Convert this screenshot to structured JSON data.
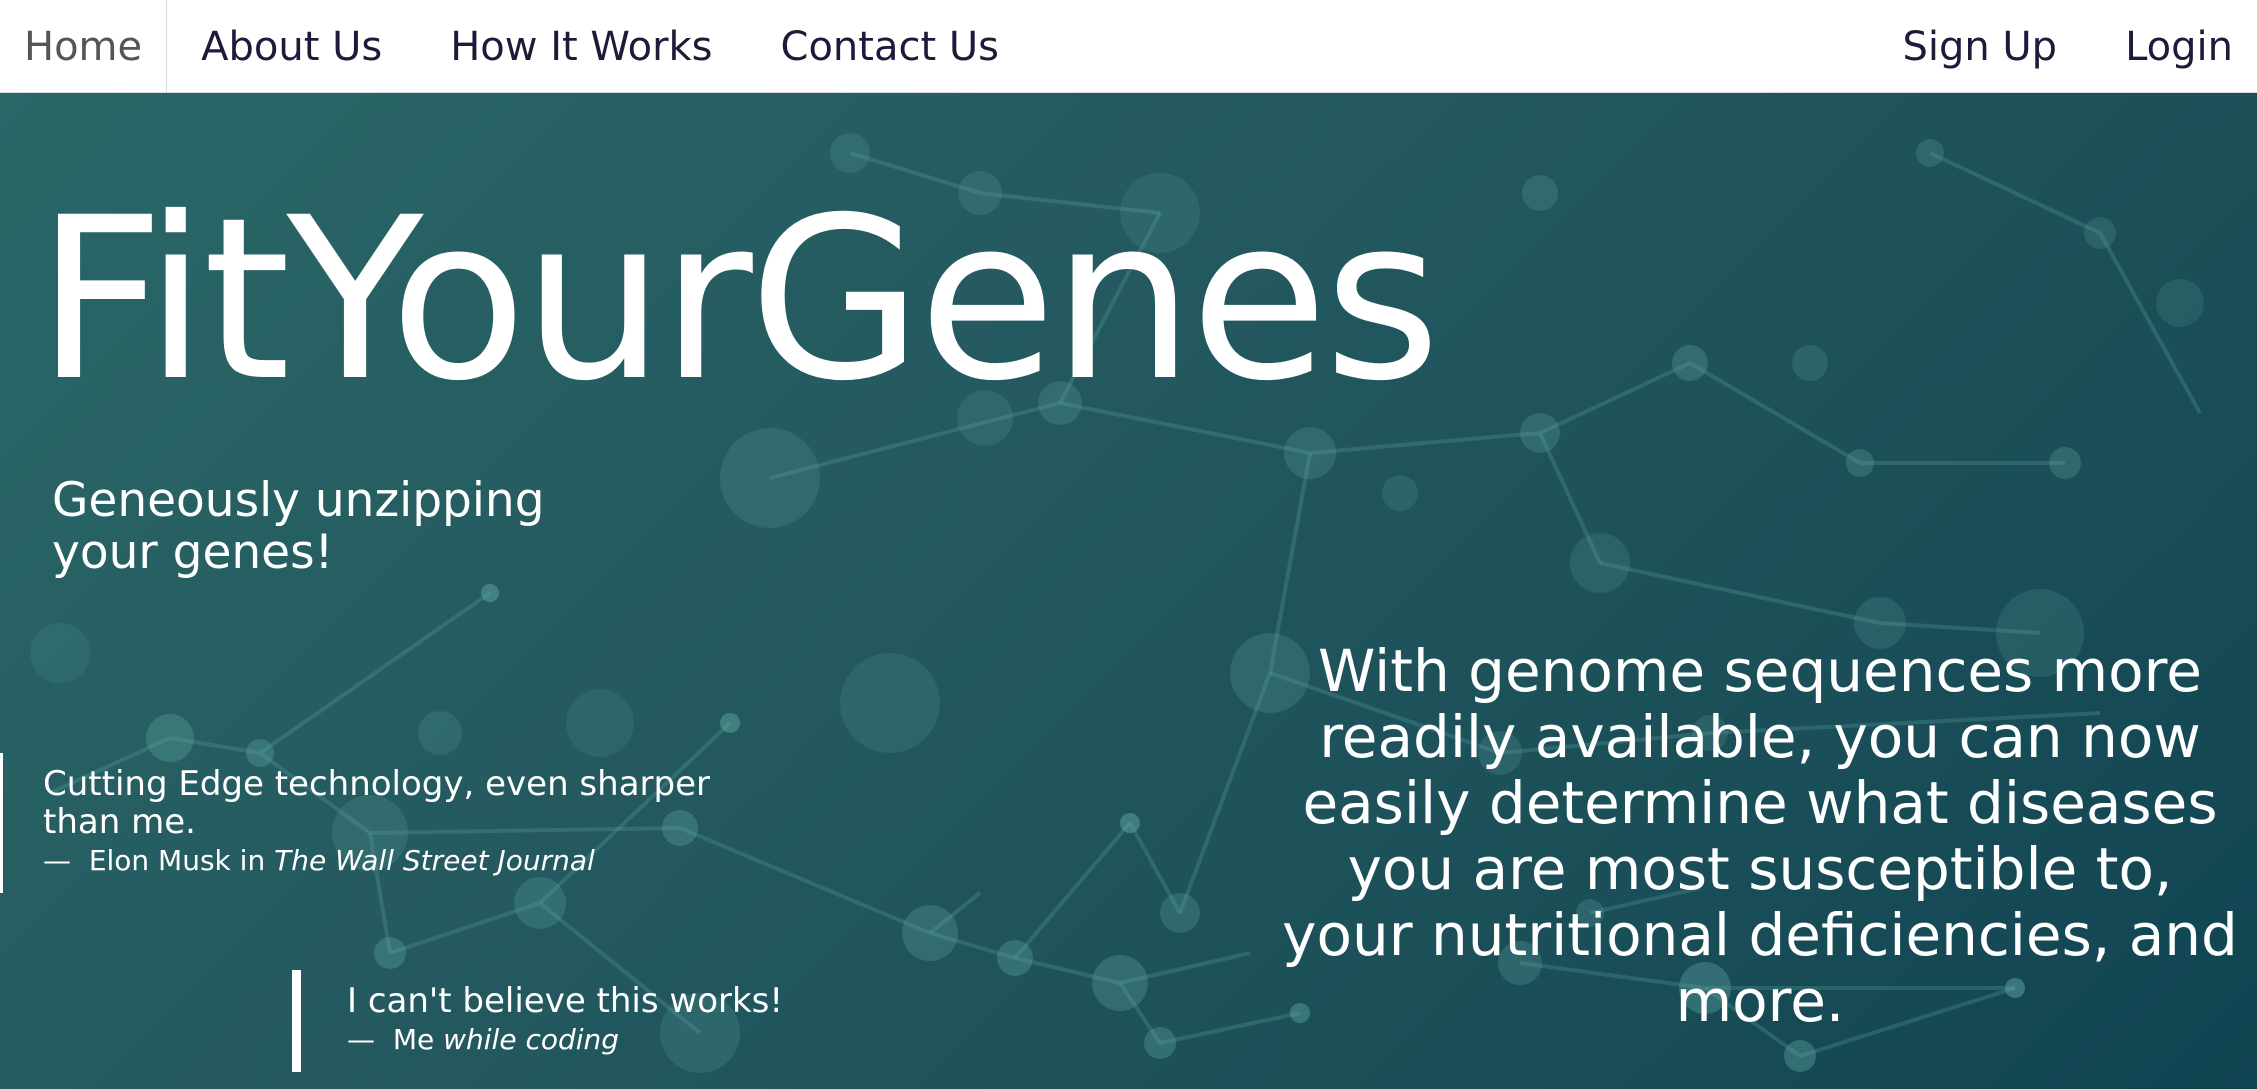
{
  "nav": {
    "left_items": [
      {
        "label": "Home",
        "active": true
      },
      {
        "label": "About Us",
        "active": false
      },
      {
        "label": "How It Works",
        "active": false
      },
      {
        "label": "Contact Us",
        "active": false
      }
    ],
    "right_items": [
      {
        "label": "Sign Up"
      },
      {
        "label": "Login"
      }
    ]
  },
  "hero": {
    "title": "FitYourGenes",
    "tagline": "Geneously unzipping your genes!",
    "blurb": "With genome sequences more readily available, you can now easily determine what diseases you are most susceptible to, your nutritional deficiencies, and more.",
    "quotes": [
      {
        "text": "Cutting Edge technology, even sharper than me.",
        "dash": "—",
        "author": "Elon Musk in",
        "source": "The Wall Street Journal"
      },
      {
        "text": "I can't believe this works!",
        "dash": "—",
        "author": "Me",
        "source": "while coding"
      }
    ]
  },
  "colors": {
    "hero_bg_start": "#2a6767",
    "hero_bg_end": "#0f4452",
    "nav_text": "#1d1b3a",
    "nav_active_text": "#555555",
    "hero_text": "#ffffff"
  }
}
